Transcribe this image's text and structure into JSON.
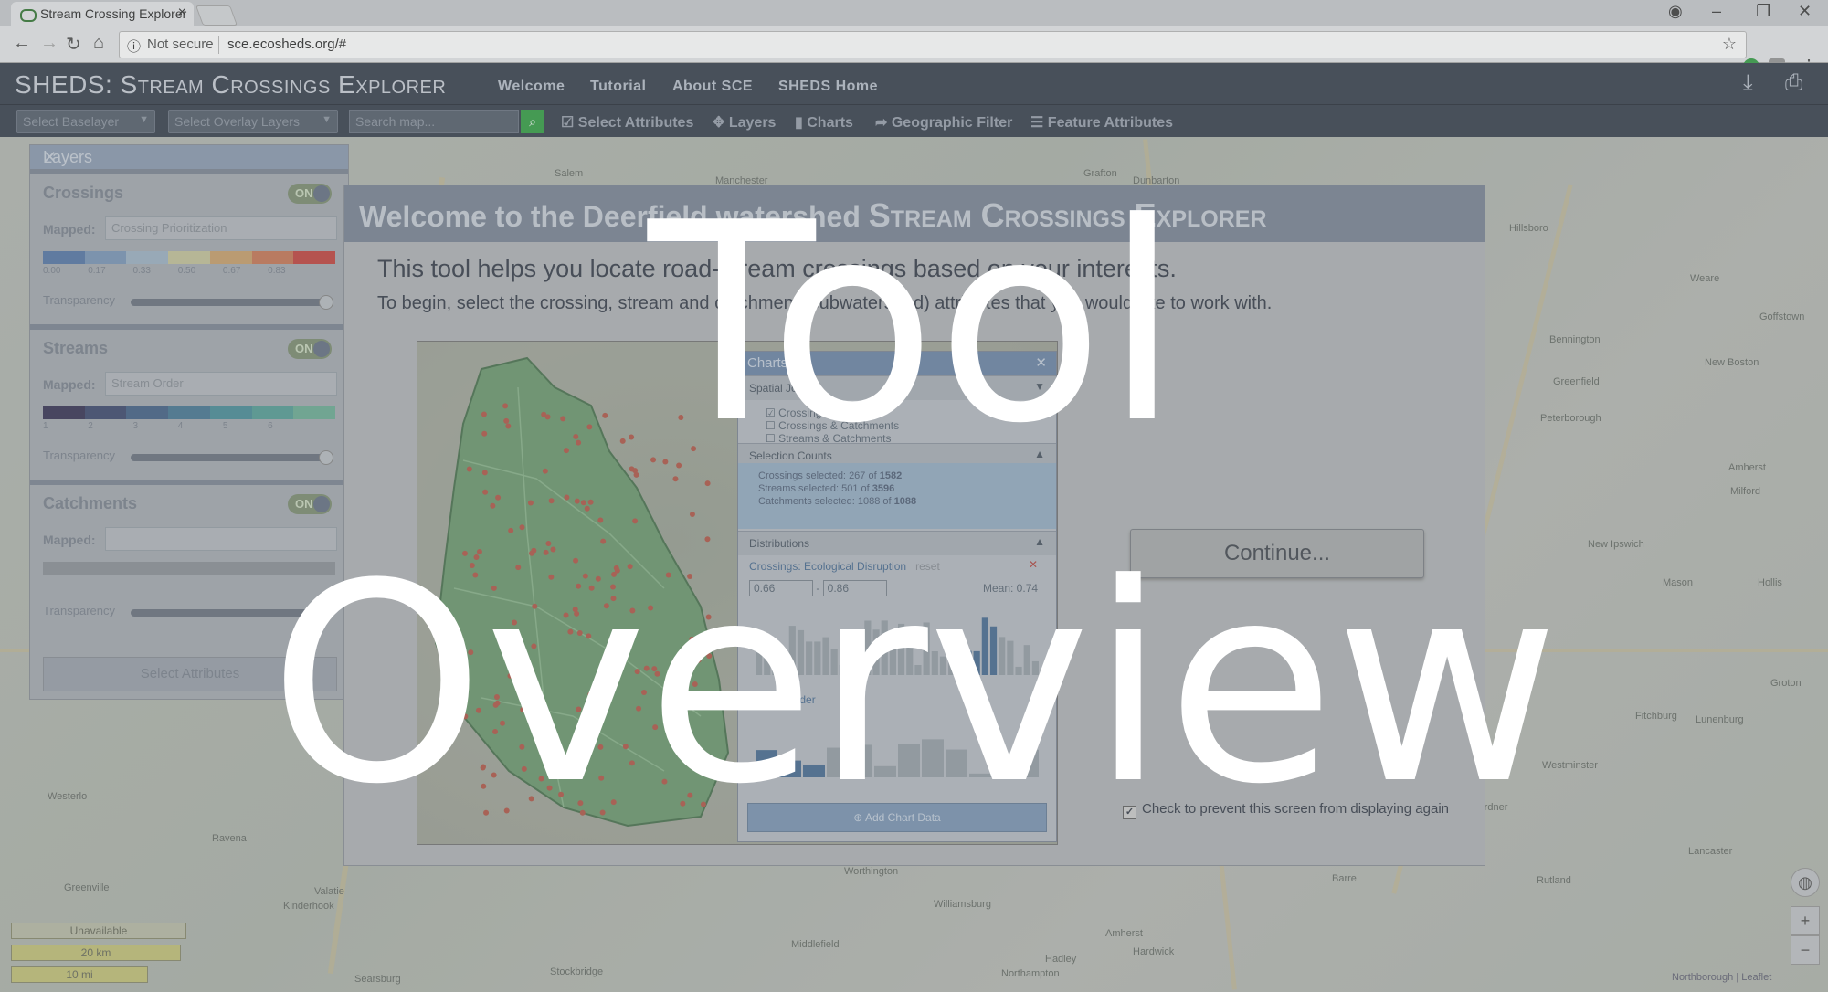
{
  "browser": {
    "tab_title": "Stream Crossing Explorer",
    "security": "Not secure",
    "url": "sce.ecosheds.org/#"
  },
  "app": {
    "brand": "SHEDS: Stream Crossings Explorer",
    "nav": [
      "Welcome",
      "Tutorial",
      "About SCE",
      "SHEDS Home"
    ],
    "toolbar": {
      "baselayer_placeholder": "Select Baselayer",
      "overlay_placeholder": "Select Overlay Layers",
      "search_placeholder": "Search map...",
      "buttons": [
        "Select Attributes",
        "Layers",
        "Charts",
        "Geographic Filter",
        "Feature Attributes"
      ]
    }
  },
  "layers_panel": {
    "title": "Layers",
    "toggle_label": "ON",
    "mapped_label": "Mapped:",
    "transparency_label": "Transparency",
    "select_attributes": "Select Attributes",
    "sections": [
      {
        "name": "Crossings",
        "mapped": "Crossing Prioritization",
        "ticks": [
          "0.00",
          "0.17",
          "0.33",
          "0.50",
          "0.67",
          "0.83"
        ]
      },
      {
        "name": "Streams",
        "mapped": "Stream Order",
        "ticks": [
          "1",
          "2",
          "3",
          "4",
          "5",
          "6"
        ]
      },
      {
        "name": "Catchments",
        "mapped": "",
        "ticks": []
      }
    ],
    "colors": {
      "crossings_ramp": [
        "#5b7aa8",
        "#7d98b8",
        "#9fb3c4",
        "#c4c29b",
        "#c9a26f",
        "#c77b5b",
        "#c24a45"
      ],
      "streams_ramp": [
        "#3d3a5a",
        "#444f72",
        "#4a6689",
        "#4c7b95",
        "#4f8f9a",
        "#5a9f98",
        "#6fae97"
      ]
    }
  },
  "scale": {
    "unavailable": "Unavailable",
    "km": "20 km",
    "mi": "10 mi"
  },
  "map_towns": [
    "Salem",
    "Manchester",
    "Dunbarton",
    "Grafton",
    "Hillsboro",
    "Weare",
    "Goffstown",
    "Bennington",
    "Greenfield",
    "New Boston",
    "Peterborough",
    "Amherst",
    "Milford",
    "New Ipswich",
    "Mason",
    "Hollis",
    "Fitchburg",
    "Lunenburg",
    "Groton",
    "Westminster",
    "Gardner",
    "Rutland",
    "Lancaster",
    "Greenville",
    "Kinderhook",
    "Valatie",
    "Stockbridge",
    "Northampton",
    "Hadley",
    "Amherst",
    "Hardwick",
    "Barre",
    "Williamsburg",
    "Worthington",
    "Middlefield",
    "Searsburg",
    "Ravena",
    "Westerlo"
  ],
  "attribution": "Northborough | Leaflet",
  "modal": {
    "title_prefix": "Welcome to the Deerfield watershed",
    "title_app": "Stream Crossings Explorer",
    "intro": "This tool helps you locate road-stream crossings based on your interests.",
    "sub": "To begin, select the crossing, stream and catchment (subwatershed) attributes that you would like to work with.",
    "continue": "Continue...",
    "dont_show": "Check to prevent this screen from displaying again",
    "preview": {
      "chart_title": "Charts",
      "spatial_join": "Spatial Join",
      "options": [
        "Crossings Only",
        "Crossings & Catchments",
        "Streams & Catchments"
      ],
      "counts_title": "Selection Counts",
      "counts": [
        {
          "label": "Crossings selected:",
          "sel": "267",
          "of": "of",
          "total": "1582"
        },
        {
          "label": "Streams selected:",
          "sel": "501",
          "of": "of",
          "total": "3596"
        },
        {
          "label": "Catchments selected:",
          "sel": "1088",
          "of": "of",
          "total": "1088"
        }
      ],
      "dist_title": "Distributions",
      "dist_var": "Crossings: Ecological Disruption",
      "reset": "reset",
      "min": "0.66",
      "max": "0.86",
      "mean": "Mean: 0.74",
      "stream_label": "Stream Order",
      "add_chart": "Add Chart Data"
    }
  },
  "overlay": {
    "line1": "Tool",
    "line2": "Overview"
  }
}
